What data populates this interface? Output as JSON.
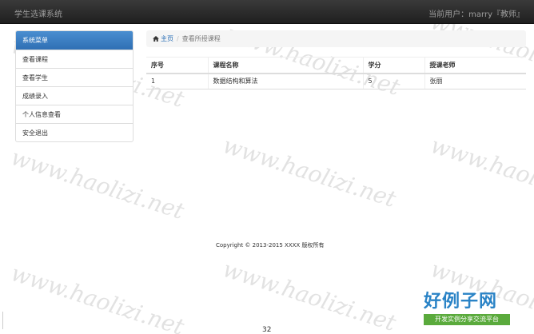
{
  "navbar": {
    "brand": "学生选课系统",
    "user_info": "当前用户：marry『教师』"
  },
  "sidebar": {
    "header": "系统菜单",
    "items": [
      {
        "label": "查看课程"
      },
      {
        "label": "查看学生"
      },
      {
        "label": "成绩录入"
      },
      {
        "label": "个人信息查看"
      },
      {
        "label": "安全退出"
      }
    ]
  },
  "breadcrumb": {
    "home": "主页",
    "separator": "/",
    "current": "查看所授课程"
  },
  "table": {
    "headers": [
      "序号",
      "课程名称",
      "学分",
      "授课老师"
    ],
    "rows": [
      [
        "1",
        "数据结构和算法",
        "5",
        "张丽"
      ]
    ]
  },
  "footer": {
    "copyright": "Copyright © 2013-2015 XXXX 版权所有"
  },
  "page_number": "32",
  "watermark": "www.haolizi.net",
  "logo": {
    "main": "好例子网",
    "sub": "开发实例分享交流平台"
  }
}
